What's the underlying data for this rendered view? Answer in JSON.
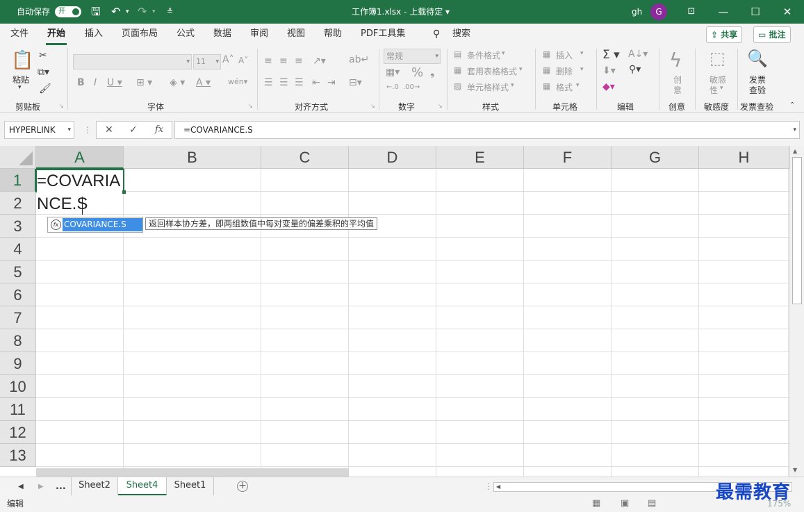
{
  "titlebar": {
    "autosave_label": "自动保存",
    "autosave_toggle": "开",
    "file_title": "工作簿1.xlsx - 上载待定 ▾",
    "user_name": "gh",
    "avatar_letter": "G"
  },
  "menu": {
    "tabs": [
      "文件",
      "开始",
      "插入",
      "页面布局",
      "公式",
      "数据",
      "审阅",
      "视图",
      "帮助",
      "PDF工具集"
    ],
    "search_label": "搜索",
    "share_label": "共享",
    "comment_label": "批注"
  },
  "ribbon": {
    "clipboard": {
      "paste": "粘贴",
      "group": "剪贴板"
    },
    "font": {
      "font_size": "11",
      "group": "字体"
    },
    "alignment": {
      "group": "对齐方式"
    },
    "number": {
      "format": "常规",
      "percent": "%",
      "group": "数字"
    },
    "styles": {
      "conditional": "条件格式",
      "table": "套用表格格式",
      "cell": "单元格样式",
      "group": "样式"
    },
    "cells": {
      "insert": "插入",
      "delete": "删除",
      "format": "格式",
      "group": "单元格"
    },
    "editing": {
      "group": "编辑"
    },
    "creativity": {
      "label1": "创",
      "label2": "意",
      "group": "创意"
    },
    "sensitivity": {
      "label1": "敏感",
      "label2": "性",
      "group": "敏感度"
    },
    "invoice": {
      "label1": "发票",
      "label2": "查验",
      "group": "发票查验"
    }
  },
  "formula_bar": {
    "name_box": "HYPERLINK",
    "cancel": "✕",
    "enter": "✓",
    "fx": "fx",
    "formula": "=COVARIANCE.S"
  },
  "grid": {
    "columns": [
      "A",
      "B",
      "C",
      "D",
      "E",
      "F",
      "G",
      "H"
    ],
    "rows": [
      "1",
      "2",
      "3",
      "4",
      "5",
      "6",
      "7",
      "8",
      "9",
      "10",
      "11",
      "12",
      "13"
    ],
    "edit_line1": "=COVARIA",
    "edit_line2": "NCE.S",
    "autocomplete_option": "COVARIANCE.S",
    "tooltip": "返回样本协方差，即两组数值中每对变量的偏差乘积的平均值"
  },
  "sheets": {
    "ellipsis": "...",
    "tabs": [
      "Sheet2",
      "Sheet4",
      "Sheet1"
    ],
    "active": "Sheet4"
  },
  "status": {
    "mode": "编辑",
    "zoom": "175%",
    "watermark": "最需教育"
  }
}
